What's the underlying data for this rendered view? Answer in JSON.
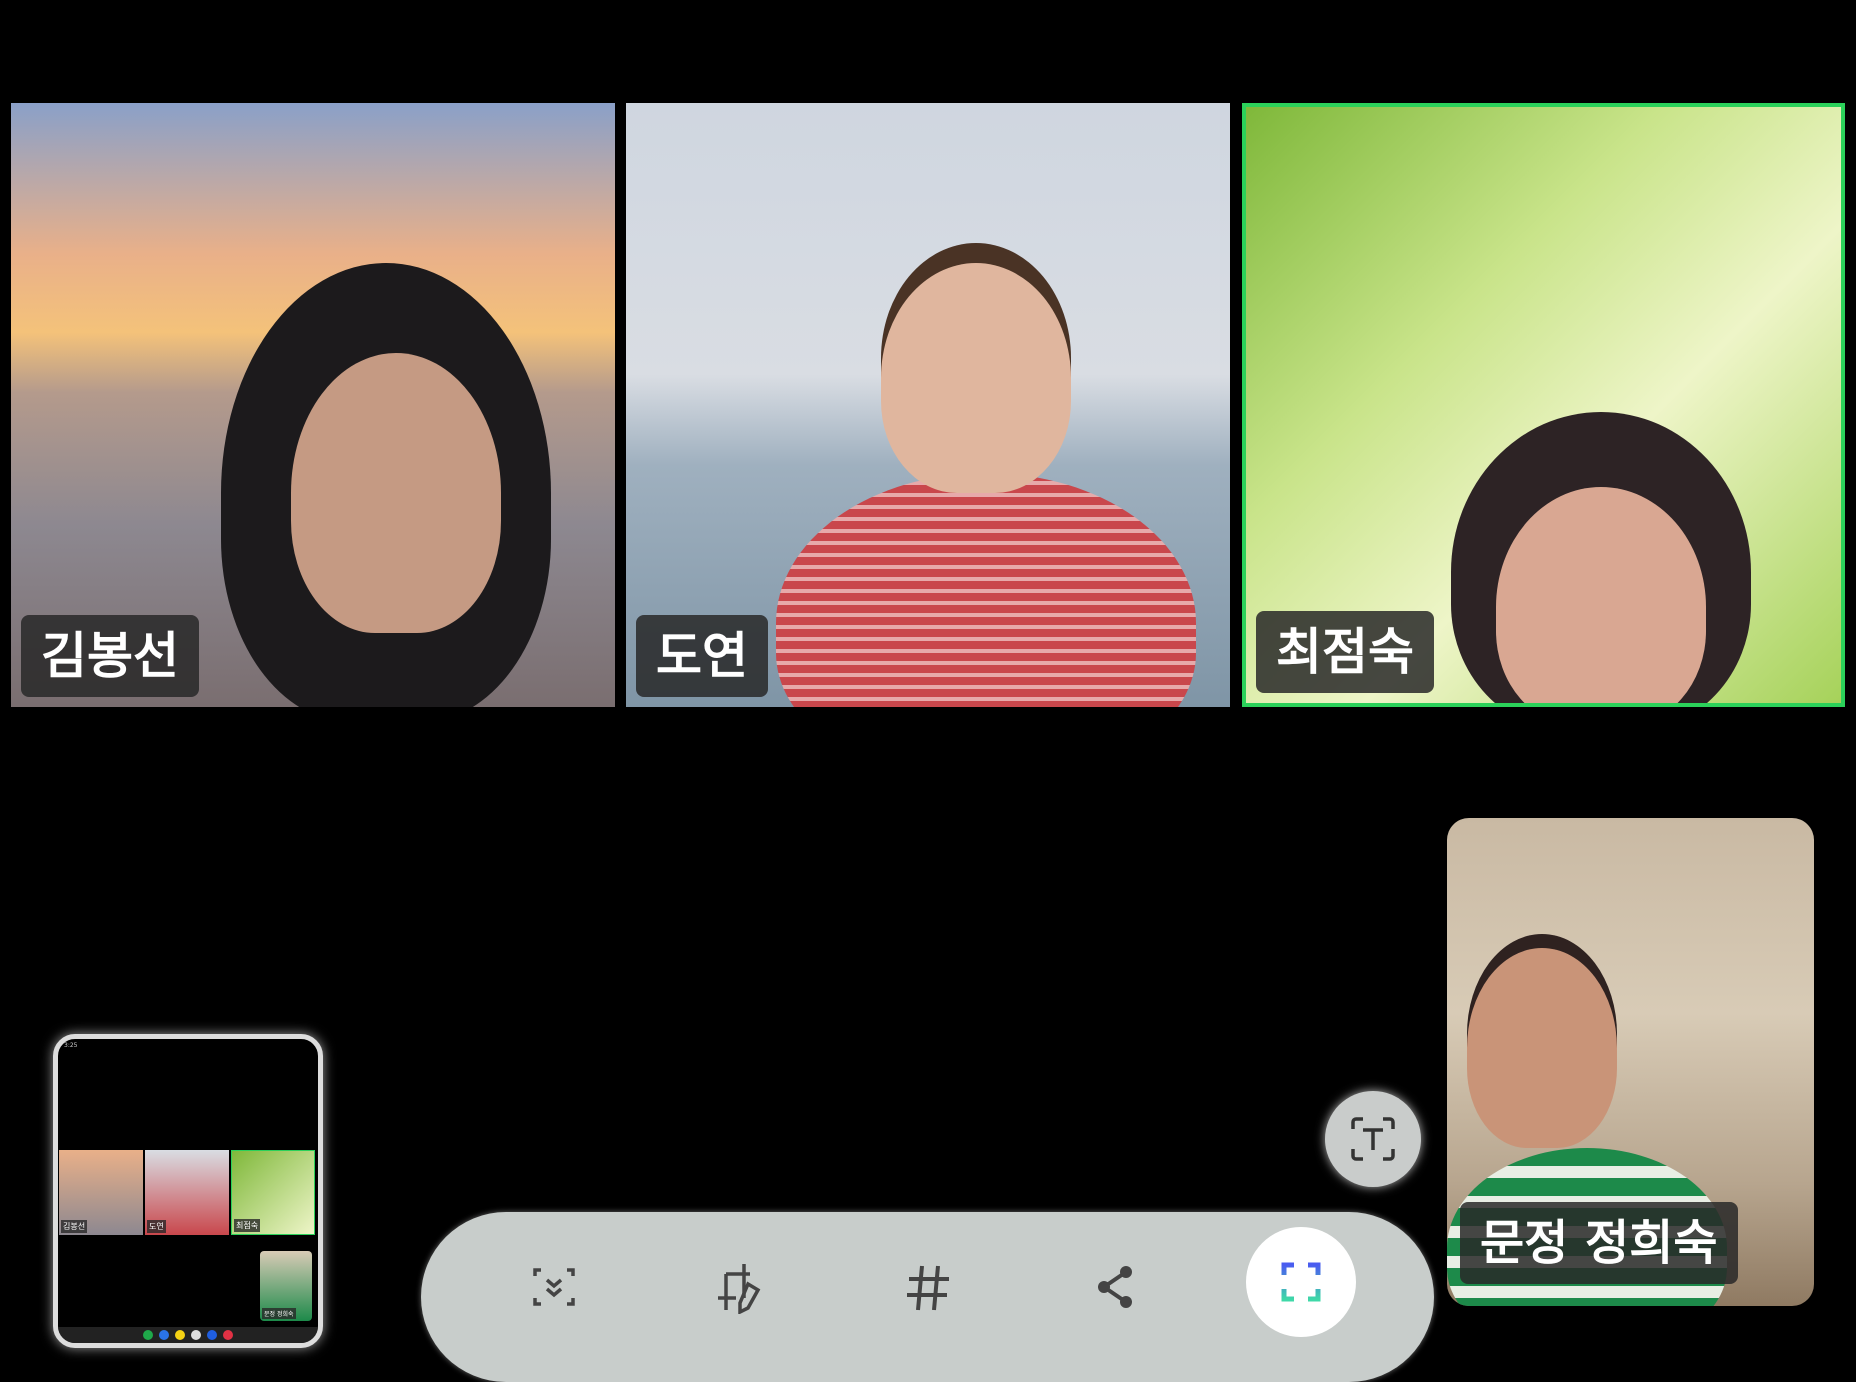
{
  "participants": [
    {
      "name": "김봉선",
      "active": false
    },
    {
      "name": "도연",
      "active": false
    },
    {
      "name": "최점숙",
      "active": true
    }
  ],
  "self_view": {
    "name": "문정 정희숙"
  },
  "toolbar": {
    "items": [
      "scroll-capture",
      "draw",
      "tag",
      "share",
      "capture-area"
    ]
  },
  "thumbnail": {
    "status_time": "3:25",
    "names": [
      "김봉선",
      "도연",
      "최점숙",
      "문정 정희숙"
    ]
  },
  "colors": {
    "active_border": "#2bd15a",
    "toolbar_bg": "#c8cdcb"
  }
}
